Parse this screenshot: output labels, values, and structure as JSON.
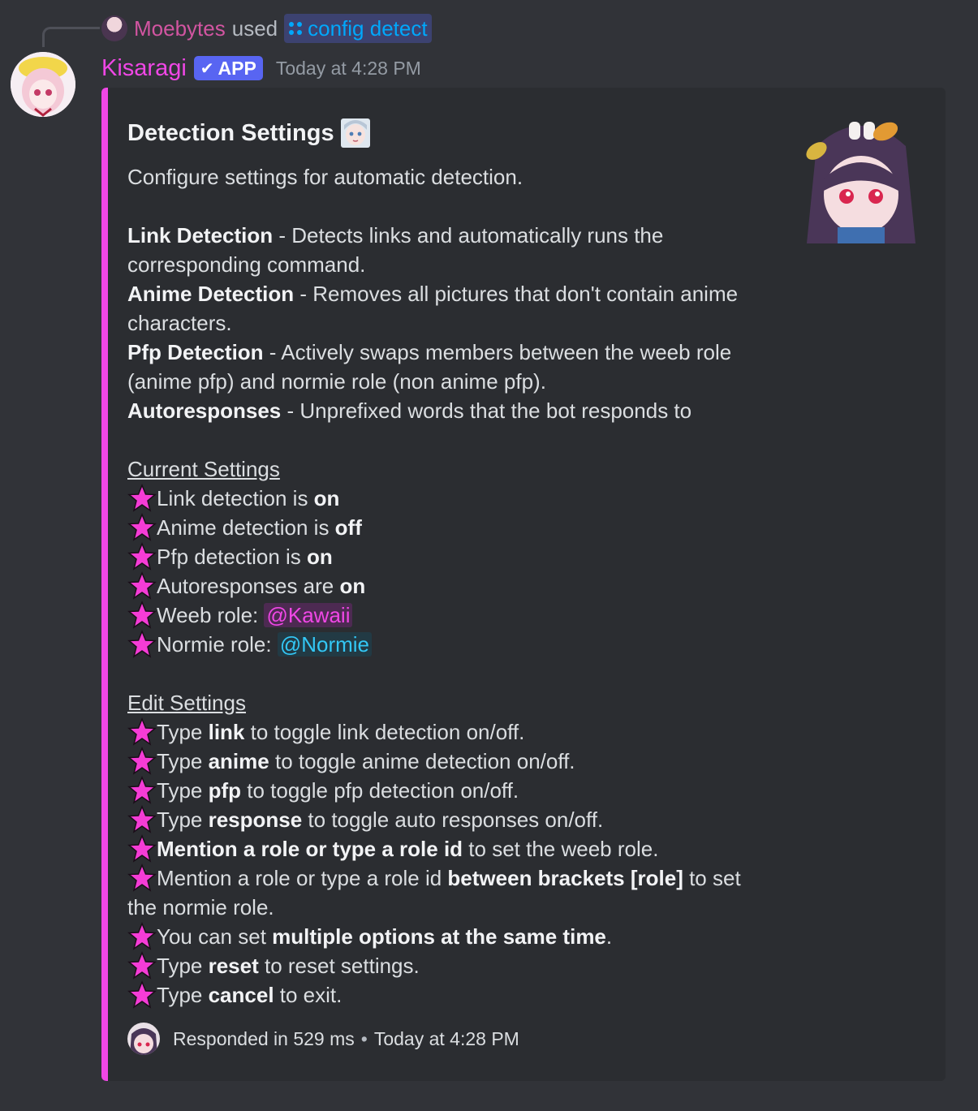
{
  "reply": {
    "user": "Moebytes",
    "used": "used",
    "command": "config detect"
  },
  "message": {
    "username": "Kisaragi",
    "badge": "APP",
    "timestamp": "Today at 4:28 PM"
  },
  "embed": {
    "accent_color": "#f047e6",
    "title": "Detection Settings",
    "description": "Configure settings for automatic detection.",
    "features": [
      {
        "name": "Link Detection",
        "text": " - Detects links and automatically runs the",
        "cont": "corresponding command."
      },
      {
        "name": "Anime Detection",
        "text": " - Removes all pictures that don't contain anime",
        "cont": "characters."
      },
      {
        "name": "Pfp Detection",
        "text": " - Actively swaps members between the weeb role",
        "cont": "(anime pfp) and normie role (non anime pfp)."
      },
      {
        "name": "Autoresponses",
        "text": " - Unprefixed words that the bot responds to"
      }
    ],
    "current_heading": "Current Settings",
    "current": {
      "link_pre": "Link detection is ",
      "link_val": "on",
      "anime_pre": "Anime detection is ",
      "anime_val": "off",
      "pfp_pre": "Pfp detection is ",
      "pfp_val": "on",
      "auto_pre": "Autoresponses are ",
      "auto_val": "on",
      "weeb_pre": "Weeb role: ",
      "weeb_role": "@Kawaii",
      "normie_pre": "Normie role: ",
      "normie_role": "@Normie"
    },
    "edit_heading": "Edit Settings",
    "edit": {
      "l1a": "Type ",
      "l1b": "link",
      "l1c": " to toggle link detection on/off.",
      "l2a": "Type ",
      "l2b": "anime",
      "l2c": " to toggle anime detection on/off.",
      "l3a": "Type ",
      "l3b": "pfp",
      "l3c": " to toggle pfp detection on/off.",
      "l4a": "Type ",
      "l4b": "response",
      "l4c": " to toggle auto responses on/off.",
      "l5b": "Mention a role or type a role id",
      "l5c": " to set the weeb role.",
      "l6a": "Mention a role or type a role id ",
      "l6b": "between brackets [role]",
      "l6c": " to set",
      "l6d": "the normie role.",
      "l7a": "You can set ",
      "l7b": "multiple options at the same time",
      "l7c": ".",
      "l8a": "Type ",
      "l8b": "reset",
      "l8c": " to reset settings.",
      "l9a": "Type ",
      "l9b": "cancel",
      "l9c": " to exit."
    },
    "footer": {
      "text": "Responded in 529 ms",
      "separator": "•",
      "timestamp": "Today at 4:28 PM"
    }
  }
}
